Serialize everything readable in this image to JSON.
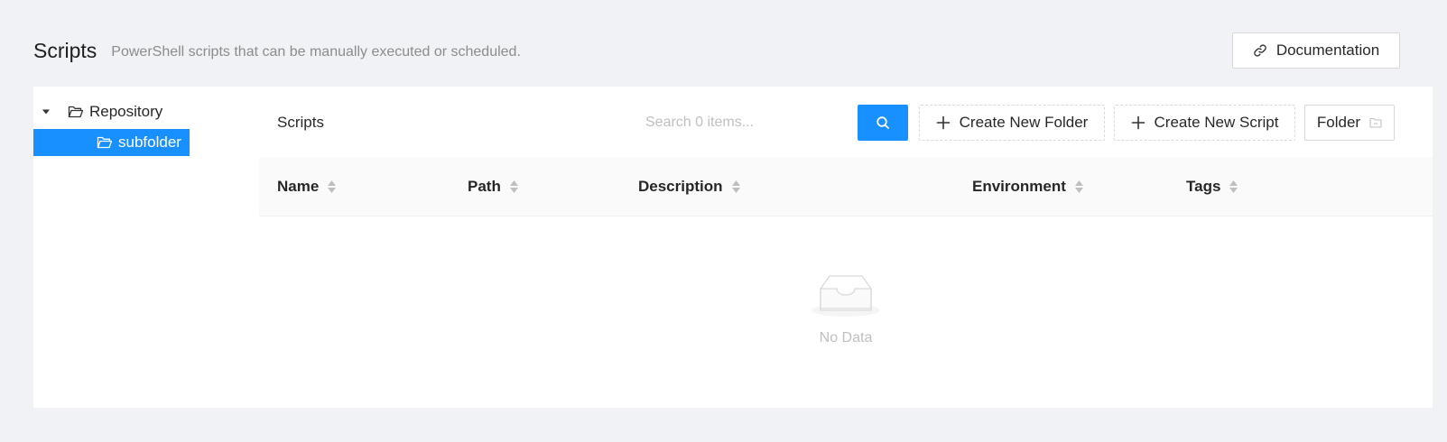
{
  "header": {
    "title": "Scripts",
    "subtitle": "PowerShell scripts that can be manually executed or scheduled.",
    "doc_button": "Documentation"
  },
  "tree": {
    "root_label": "Repository",
    "child_label": "subfolder"
  },
  "toolbar": {
    "title": "Scripts",
    "search_placeholder": "Search 0 items...",
    "create_folder": "Create New Folder",
    "create_script": "Create New Script",
    "folder_button": "Folder"
  },
  "table": {
    "columns": [
      "Name",
      "Path",
      "Description",
      "Environment",
      "Tags"
    ],
    "empty_text": "No Data"
  },
  "colors": {
    "primary": "#1890ff",
    "background": "#f0f2f5"
  }
}
